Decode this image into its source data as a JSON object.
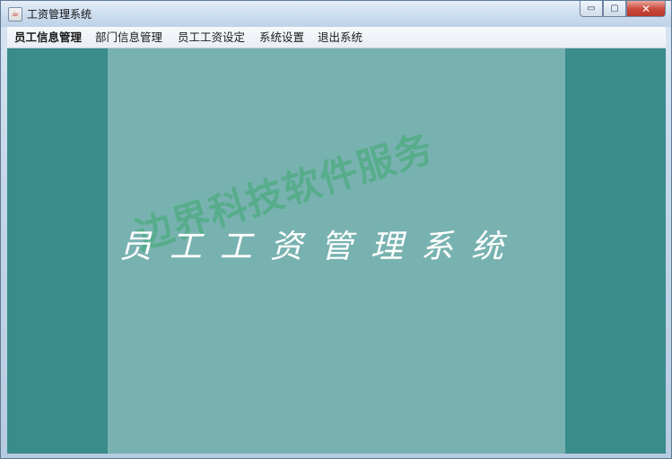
{
  "window": {
    "title": "工资管理系统",
    "title_ghost": "...",
    "icon": "java-cup-icon",
    "controls": {
      "minimize": "▭",
      "maximize": "▢",
      "close": "✕"
    }
  },
  "menubar": {
    "items": [
      {
        "label": "员工信息管理",
        "active": true
      },
      {
        "label": "部门信息管理",
        "active": false
      },
      {
        "label": "员工工资设定",
        "active": false
      },
      {
        "label": "系统设置",
        "active": false
      },
      {
        "label": "退出系统",
        "active": false
      }
    ]
  },
  "content": {
    "title": "员工工资管理系统",
    "watermark": "边界科技软件服务"
  },
  "colors": {
    "background": "#3a8b8b",
    "panel": "#78b2b0",
    "watermark": "#3caa6e",
    "title": "#ffffff"
  }
}
